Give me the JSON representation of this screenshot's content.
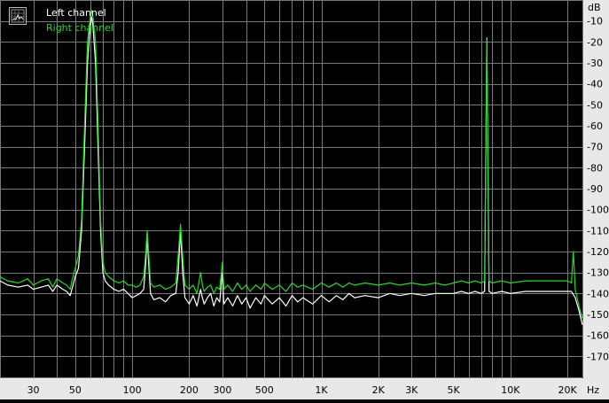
{
  "legend": {
    "left_label": "Left channel",
    "right_label": "Right channel"
  },
  "colors": {
    "background": "#000000",
    "grid": "#7a7a7a",
    "axis_band": "#e8e8e8",
    "left_channel": "#ffffff",
    "right_channel": "#22dd22"
  },
  "chart_data": {
    "type": "line",
    "xscale": "log",
    "xlim": [
      20,
      24000
    ],
    "ylim": [
      -180,
      0
    ],
    "xunit": "Hz",
    "yunit": "dB",
    "grid": true,
    "legend_position": "top-left",
    "x_tick_labels": [
      {
        "value": 30,
        "label": "30"
      },
      {
        "value": 50,
        "label": "50"
      },
      {
        "value": 100,
        "label": "100"
      },
      {
        "value": 200,
        "label": "200"
      },
      {
        "value": 300,
        "label": "300"
      },
      {
        "value": 500,
        "label": "500"
      },
      {
        "value": 1000,
        "label": "1K"
      },
      {
        "value": 2000,
        "label": "2K"
      },
      {
        "value": 3000,
        "label": "3K"
      },
      {
        "value": 5000,
        "label": "5K"
      },
      {
        "value": 10000,
        "label": "10K"
      },
      {
        "value": 20000,
        "label": "20K"
      }
    ],
    "y_tick_labels": [
      "-10",
      "-20",
      "-30",
      "-40",
      "-50",
      "-60",
      "-70",
      "-80",
      "-90",
      "-100",
      "-110",
      "-120",
      "-130",
      "-140",
      "-150",
      "-160",
      "-170"
    ],
    "y_tick_values": [
      -10,
      -20,
      -30,
      -40,
      -50,
      -60,
      -70,
      -80,
      -90,
      -100,
      -110,
      -120,
      -130,
      -140,
      -150,
      -160,
      -170
    ],
    "series": [
      {
        "name": "Left channel",
        "color": "#ffffff",
        "points": [
          [
            20,
            -134
          ],
          [
            22,
            -136
          ],
          [
            25,
            -137
          ],
          [
            28,
            -136
          ],
          [
            30,
            -138
          ],
          [
            33,
            -137
          ],
          [
            36,
            -136
          ],
          [
            38,
            -139
          ],
          [
            40,
            -136
          ],
          [
            43,
            -138
          ],
          [
            45,
            -139
          ],
          [
            47,
            -141
          ],
          [
            48,
            -138
          ],
          [
            50,
            -132
          ],
          [
            52,
            -128
          ],
          [
            54,
            -110
          ],
          [
            56,
            -70
          ],
          [
            58,
            -30
          ],
          [
            60,
            -12
          ],
          [
            61,
            -8
          ],
          [
            62,
            -12
          ],
          [
            64,
            -30
          ],
          [
            66,
            -70
          ],
          [
            68,
            -110
          ],
          [
            70,
            -130
          ],
          [
            72,
            -134
          ],
          [
            75,
            -136
          ],
          [
            80,
            -138
          ],
          [
            85,
            -139
          ],
          [
            90,
            -138
          ],
          [
            95,
            -140
          ],
          [
            100,
            -142
          ],
          [
            105,
            -141
          ],
          [
            110,
            -140
          ],
          [
            115,
            -138
          ],
          [
            118,
            -125
          ],
          [
            120,
            -112
          ],
          [
            122,
            -125
          ],
          [
            125,
            -140
          ],
          [
            130,
            -143
          ],
          [
            140,
            -142
          ],
          [
            150,
            -144
          ],
          [
            160,
            -141
          ],
          [
            170,
            -140
          ],
          [
            175,
            -130
          ],
          [
            180,
            -110
          ],
          [
            185,
            -130
          ],
          [
            190,
            -142
          ],
          [
            200,
            -145
          ],
          [
            210,
            -141
          ],
          [
            220,
            -146
          ],
          [
            230,
            -138
          ],
          [
            235,
            -142
          ],
          [
            240,
            -145
          ],
          [
            250,
            -142
          ],
          [
            260,
            -140
          ],
          [
            270,
            -146
          ],
          [
            280,
            -142
          ],
          [
            290,
            -144
          ],
          [
            300,
            -130
          ],
          [
            305,
            -145
          ],
          [
            320,
            -142
          ],
          [
            340,
            -146
          ],
          [
            360,
            -141
          ],
          [
            380,
            -145
          ],
          [
            400,
            -142
          ],
          [
            420,
            -147
          ],
          [
            450,
            -142
          ],
          [
            480,
            -145
          ],
          [
            500,
            -141
          ],
          [
            550,
            -145
          ],
          [
            600,
            -142
          ],
          [
            650,
            -146
          ],
          [
            700,
            -141
          ],
          [
            750,
            -144
          ],
          [
            800,
            -142
          ],
          [
            900,
            -145
          ],
          [
            1000,
            -141
          ],
          [
            1100,
            -144
          ],
          [
            1200,
            -141
          ],
          [
            1300,
            -143
          ],
          [
            1400,
            -140
          ],
          [
            1500,
            -142
          ],
          [
            1700,
            -141
          ],
          [
            2000,
            -142
          ],
          [
            2300,
            -140
          ],
          [
            2600,
            -141
          ],
          [
            3000,
            -140
          ],
          [
            3500,
            -141
          ],
          [
            4000,
            -140
          ],
          [
            4500,
            -140
          ],
          [
            5000,
            -140
          ],
          [
            5500,
            -139
          ],
          [
            6000,
            -140
          ],
          [
            6500,
            -139
          ],
          [
            7000,
            -140
          ],
          [
            7300,
            -139
          ],
          [
            7500,
            -18
          ],
          [
            7700,
            -139
          ],
          [
            8000,
            -140
          ],
          [
            9000,
            -139
          ],
          [
            10000,
            -140
          ],
          [
            12000,
            -139
          ],
          [
            15000,
            -139
          ],
          [
            18000,
            -139
          ],
          [
            20000,
            -139
          ],
          [
            21000,
            -139
          ],
          [
            22000,
            -142
          ],
          [
            23000,
            -148
          ],
          [
            24000,
            -155
          ]
        ]
      },
      {
        "name": "Right channel",
        "color": "#22dd22",
        "points": [
          [
            20,
            -132
          ],
          [
            22,
            -134
          ],
          [
            25,
            -135
          ],
          [
            28,
            -133
          ],
          [
            30,
            -136
          ],
          [
            33,
            -134
          ],
          [
            36,
            -133
          ],
          [
            38,
            -137
          ],
          [
            40,
            -133
          ],
          [
            43,
            -135
          ],
          [
            45,
            -136
          ],
          [
            47,
            -138
          ],
          [
            48,
            -134
          ],
          [
            50,
            -128
          ],
          [
            52,
            -122
          ],
          [
            54,
            -105
          ],
          [
            56,
            -60
          ],
          [
            58,
            -20
          ],
          [
            60,
            -8
          ],
          [
            61,
            -5
          ],
          [
            62,
            -8
          ],
          [
            64,
            -20
          ],
          [
            66,
            -60
          ],
          [
            68,
            -105
          ],
          [
            70,
            -125
          ],
          [
            72,
            -130
          ],
          [
            75,
            -132
          ],
          [
            80,
            -134
          ],
          [
            85,
            -135
          ],
          [
            90,
            -134
          ],
          [
            95,
            -136
          ],
          [
            100,
            -136
          ],
          [
            105,
            -137
          ],
          [
            110,
            -136
          ],
          [
            115,
            -132
          ],
          [
            118,
            -120
          ],
          [
            120,
            -110
          ],
          [
            122,
            -120
          ],
          [
            125,
            -135
          ],
          [
            130,
            -137
          ],
          [
            140,
            -136
          ],
          [
            150,
            -138
          ],
          [
            160,
            -137
          ],
          [
            170,
            -135
          ],
          [
            175,
            -122
          ],
          [
            180,
            -107
          ],
          [
            185,
            -122
          ],
          [
            190,
            -136
          ],
          [
            200,
            -138
          ],
          [
            210,
            -136
          ],
          [
            220,
            -140
          ],
          [
            230,
            -130
          ],
          [
            235,
            -136
          ],
          [
            240,
            -139
          ],
          [
            250,
            -137
          ],
          [
            260,
            -136
          ],
          [
            270,
            -140
          ],
          [
            280,
            -137
          ],
          [
            290,
            -138
          ],
          [
            300,
            -125
          ],
          [
            305,
            -138
          ],
          [
            320,
            -136
          ],
          [
            340,
            -139
          ],
          [
            360,
            -135
          ],
          [
            380,
            -138
          ],
          [
            400,
            -136
          ],
          [
            420,
            -139
          ],
          [
            450,
            -136
          ],
          [
            480,
            -138
          ],
          [
            500,
            -135
          ],
          [
            550,
            -138
          ],
          [
            600,
            -136
          ],
          [
            650,
            -139
          ],
          [
            700,
            -135
          ],
          [
            750,
            -137
          ],
          [
            800,
            -136
          ],
          [
            900,
            -138
          ],
          [
            1000,
            -135
          ],
          [
            1100,
            -137
          ],
          [
            1200,
            -135
          ],
          [
            1300,
            -137
          ],
          [
            1400,
            -135
          ],
          [
            1500,
            -136
          ],
          [
            1700,
            -135
          ],
          [
            2000,
            -136
          ],
          [
            2300,
            -135
          ],
          [
            2600,
            -136
          ],
          [
            3000,
            -135
          ],
          [
            3500,
            -136
          ],
          [
            4000,
            -135
          ],
          [
            4500,
            -136
          ],
          [
            5000,
            -135
          ],
          [
            5500,
            -134
          ],
          [
            6000,
            -135
          ],
          [
            6500,
            -134
          ],
          [
            7000,
            -135
          ],
          [
            7300,
            -134
          ],
          [
            7500,
            -18
          ],
          [
            7700,
            -134
          ],
          [
            8000,
            -135
          ],
          [
            9000,
            -134
          ],
          [
            10000,
            -135
          ],
          [
            12000,
            -134
          ],
          [
            15000,
            -134
          ],
          [
            18000,
            -134
          ],
          [
            20000,
            -134
          ],
          [
            21000,
            -135
          ],
          [
            21500,
            -120
          ],
          [
            22000,
            -138
          ],
          [
            23000,
            -146
          ],
          [
            24000,
            -152
          ]
        ]
      }
    ]
  }
}
